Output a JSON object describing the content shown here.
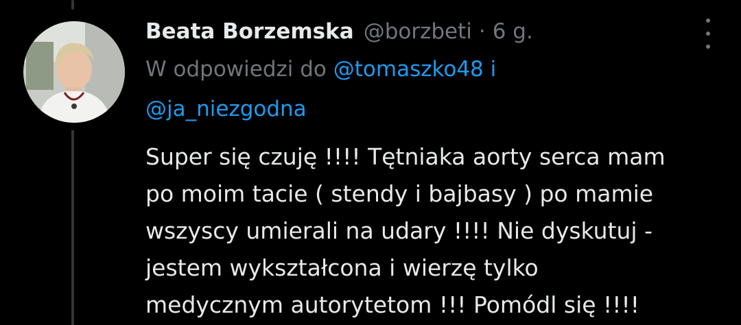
{
  "tweet": {
    "author_name": "Beata Borzemska",
    "handle": "@borzbeti",
    "separator": "·",
    "time": "6 g.",
    "reply_prefix": "W odpowiedzi do",
    "mention_1": "@tomaszko48",
    "reply_join": "i",
    "mention_2": "@ja_niezgodna",
    "text_lines": [
      "Super się czuję !!!! Tętniaka aorty serca mam",
      "po moim tacie ( stendy i bajbasy ) po mamie",
      "wszyscy umierali na udary !!!! Nie dyskutuj -",
      "jestem wykształcona i wierzę tylko",
      "medycznym autorytetom !!! Pomódl się !!!!"
    ]
  },
  "colors": {
    "background": "#000000",
    "text": "#e7e9ea",
    "muted": "#71767b",
    "link": "#1d9bf0",
    "thread_line": "#333639"
  },
  "icons": {
    "more": "more-vertical-icon"
  }
}
